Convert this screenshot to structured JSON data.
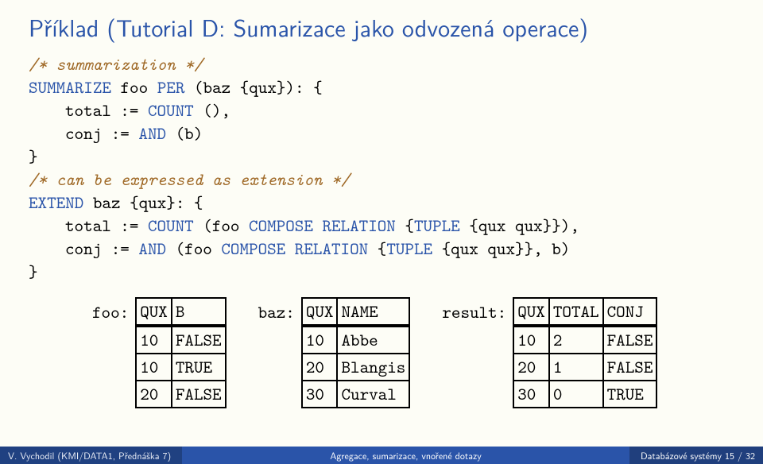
{
  "title": "Příklad (Tutorial D: Sumarizace jako odvozená operace)",
  "code": {
    "c1": "/* summarization */",
    "l2a": "SUMMARIZE",
    "l2b": " foo ",
    "l2c": "PER",
    "l2d": " (baz {qux}): {",
    "l3a": "total := ",
    "l3b": "COUNT",
    "l3c": " (),",
    "l4a": "conj := ",
    "l4b": "AND",
    "l4c": " (b)",
    "l5": "}",
    "c2": "/* can be expressed as extension */",
    "l7a": "EXTEND",
    "l7b": " baz {qux}: {",
    "l8a": "total := ",
    "l8b": "COUNT",
    "l8c": " (foo ",
    "l8d": "COMPOSE",
    "l8e": " ",
    "l8f": "RELATION",
    "l8g": " {",
    "l8h": "TUPLE",
    "l8i": " {qux qux}}),",
    "l9a": "conj := ",
    "l9b": "AND",
    "l9c": " (foo ",
    "l9d": "COMPOSE",
    "l9e": " ",
    "l9f": "RELATION",
    "l9g": " {",
    "l9h": "TUPLE",
    "l9i": " {qux qux}}, b)",
    "l10": "}"
  },
  "tables": {
    "foo": {
      "label": "foo:",
      "headers": [
        "QUX",
        "B"
      ],
      "rows": [
        [
          "10",
          "FALSE"
        ],
        [
          "10",
          "TRUE"
        ],
        [
          "20",
          "FALSE"
        ]
      ]
    },
    "baz": {
      "label": "baz:",
      "headers": [
        "QUX",
        "NAME"
      ],
      "rows": [
        [
          "10",
          "Abbe"
        ],
        [
          "20",
          "Blangis"
        ],
        [
          "30",
          "Curval"
        ]
      ]
    },
    "result": {
      "label": "result:",
      "headers": [
        "QUX",
        "TOTAL",
        "CONJ"
      ],
      "rows": [
        [
          "10",
          "2",
          "FALSE"
        ],
        [
          "20",
          "1",
          "FALSE"
        ],
        [
          "30",
          "0",
          "TRUE"
        ]
      ]
    }
  },
  "footer": {
    "left": "V. Vychodil (KMI/DATA1, Přednáška 7)",
    "center": "Agregace, sumarizace, vnořené dotazy",
    "right": "Databázové systémy    15 / 32"
  }
}
